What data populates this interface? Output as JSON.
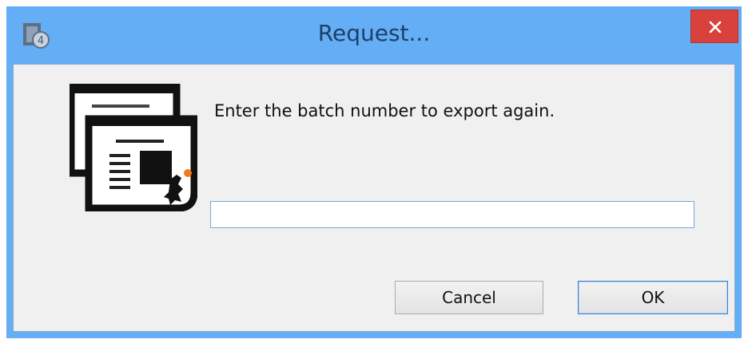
{
  "window": {
    "title": "Request...",
    "close_glyph": "✕"
  },
  "dialog": {
    "prompt": "Enter the batch number to export again.",
    "input_value": "",
    "input_placeholder": ""
  },
  "buttons": {
    "cancel_label": "Cancel",
    "ok_label": "OK"
  },
  "icons": {
    "app": "app-icon",
    "document": "document-export-icon",
    "close": "close-icon"
  },
  "colors": {
    "titlebar": "#63aef5",
    "close_button": "#d9423c",
    "client_background": "#f0f0f0",
    "default_button_border": "#3c7fd1"
  }
}
